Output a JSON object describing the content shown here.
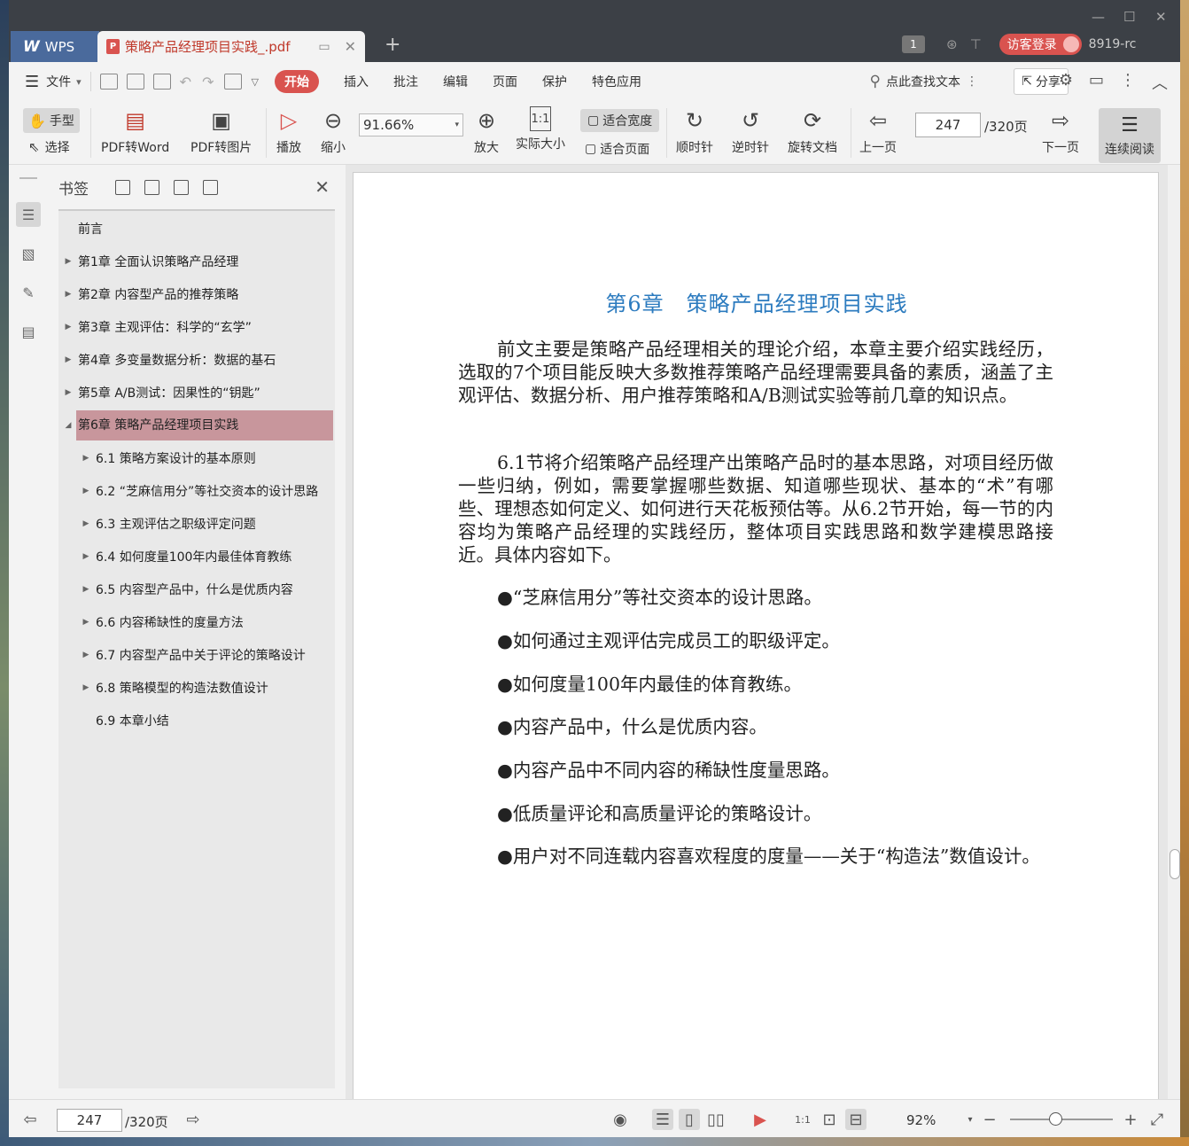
{
  "app": {
    "name": "WPS"
  },
  "tabs": {
    "doc_title": "策略产品经理项目实践_.pdf"
  },
  "titlebar": {
    "page_count_badge": "1",
    "guest_login": "访客登录",
    "user_id": "8919-rc"
  },
  "menu": {
    "file": "文件",
    "items": [
      "开始",
      "插入",
      "批注",
      "编辑",
      "页面",
      "保护",
      "特色应用"
    ],
    "search_text": "点此查找文本",
    "share": "分享"
  },
  "toolbar": {
    "hand": "手型",
    "select": "选择",
    "pdf_to_word": "PDF转Word",
    "pdf_to_image": "PDF转图片",
    "play": "播放",
    "zoom_out": "缩小",
    "zoom_value": "91.66%",
    "zoom_in": "放大",
    "actual_size": "实际大小",
    "fit_width": "适合宽度",
    "fit_page": "适合页面",
    "clockwise": "顺时针",
    "counterclockwise": "逆时针",
    "rotate_doc": "旋转文档",
    "prev_page": "上一页",
    "page_current": "247",
    "page_total": "/320页",
    "next_page": "下一页",
    "continuous_read": "连续阅读"
  },
  "bookmarks": {
    "title": "书签",
    "items": [
      {
        "label": "前言"
      },
      {
        "label": "第1章 全面认识策略产品经理"
      },
      {
        "label": "第2章 内容型产品的推荐策略"
      },
      {
        "label": "第3章 主观评估：科学的“玄学”"
      },
      {
        "label": "第4章 多变量数据分析：数据的基石"
      },
      {
        "label": "第5章 A/B测试：因果性的“钥匙”"
      },
      {
        "label": "第6章 策略产品经理项目实践"
      },
      {
        "label": "6.1 策略方案设计的基本原则"
      },
      {
        "label": "6.2 “芝麻信用分”等社交资本的设计思路"
      },
      {
        "label": "6.3 主观评估之职级评定问题"
      },
      {
        "label": "6.4 如何度量100年内最佳体育教练"
      },
      {
        "label": "6.5 内容型产品中，什么是优质内容"
      },
      {
        "label": "6.6 内容稀缺性的度量方法"
      },
      {
        "label": "6.7 内容型产品中关于评论的策略设计"
      },
      {
        "label": "6.8 策略模型的构造法数值设计"
      },
      {
        "label": "6.9 本章小结"
      }
    ]
  },
  "document": {
    "chapter_title": "第6章　策略产品经理项目实践",
    "para1": "前文主要是策略产品经理相关的理论介绍，本章主要介绍实践经历，选取的7个项目能反映大多数推荐策略产品经理需要具备的素质，涵盖了主观评估、数据分析、用户推荐策略和A/B测试实验等前几章的知识点。",
    "para2": "6.1节将介绍策略产品经理产出策略产品时的基本思路，对项目经历做一些归纳，例如，需要掌握哪些数据、知道哪些现状、基本的“术”有哪些、理想态如何定义、如何进行天花板预估等。从6.2节开始，每一节的内容均为策略产品经理的实践经历，整体项目实践思路和数学建模思路接近。具体内容如下。",
    "bullets": [
      "●“芝麻信用分”等社交资本的设计思路。",
      "●如何通过主观评估完成员工的职级评定。",
      "●如何度量100年内最佳的体育教练。",
      "●内容产品中，什么是优质内容。",
      "●内容产品中不同内容的稀缺性度量思路。",
      "●低质量评论和高质量评论的策略设计。",
      "●用户对不同连载内容喜欢程度的度量——关于“构造法”数值设计。"
    ]
  },
  "statusbar": {
    "page_current": "247",
    "page_total": "/320页",
    "zoom": "92%"
  },
  "colors": {
    "accent": "#d9534f",
    "active_bookmark": "#c8969c",
    "chapter_title": "#2c7bbf"
  }
}
